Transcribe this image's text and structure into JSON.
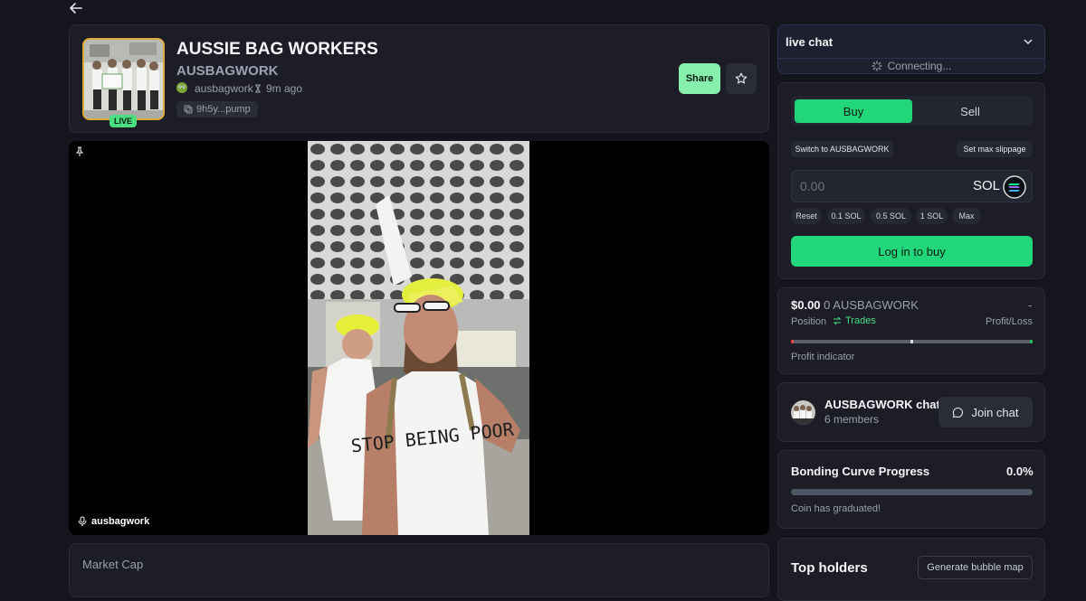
{
  "token": {
    "name": "AUSSIE BAG WORKERS",
    "ticker": "AUSBAGWORK",
    "creator": "ausbagwork",
    "age": "9m ago",
    "contract": "9h5y...pump",
    "live_badge": "LIVE",
    "share_label": "Share"
  },
  "stream": {
    "streamer": "ausbagwork",
    "shirt_text": "STOP BEING POOR"
  },
  "market": {
    "label": "Market Cap"
  },
  "chat": {
    "title": "live chat",
    "status": "Connecting..."
  },
  "trade": {
    "buy_tab": "Buy",
    "sell_tab": "Sell",
    "switch_label": "Switch to AUSBAGWORK",
    "slippage_label": "Set max slippage",
    "amount_placeholder": "0.00",
    "currency": "SOL",
    "quick_amounts": [
      "Reset",
      "0.1 SOL",
      "0.5 SOL",
      "1 SOL",
      "Max"
    ],
    "login_label": "Log in to buy"
  },
  "position": {
    "value": "$0.00",
    "amount": "0 AUSBAGWORK",
    "dash": "-",
    "position_label": "Position",
    "trades_label": "Trades",
    "pnl_label": "Profit/Loss",
    "indicator_label": "Profit indicator"
  },
  "community": {
    "name": "AUSBAGWORK chat",
    "members": "6 members",
    "join_label": "Join chat"
  },
  "bonding": {
    "title": "Bonding Curve Progress",
    "percent": "0.0%",
    "progress": 0,
    "status": "Coin has graduated!"
  },
  "holders": {
    "title": "Top holders",
    "bubble_label": "Generate bubble map"
  },
  "colors": {
    "accent": "#4ade80",
    "accent_dark": "#22c55e",
    "background": "#15161d",
    "card": "#1c1d26"
  }
}
